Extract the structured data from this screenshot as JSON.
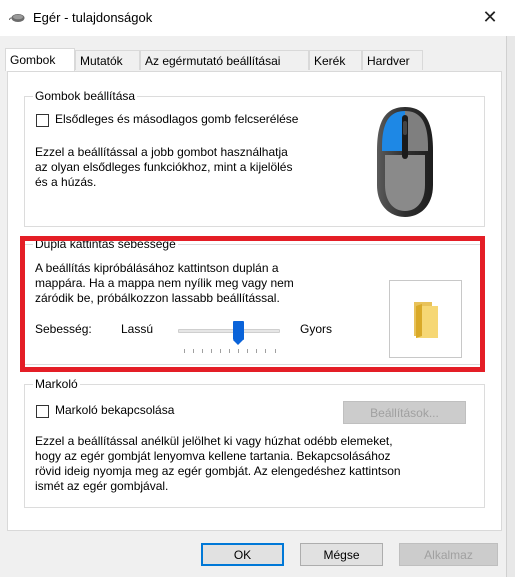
{
  "window": {
    "title": "Egér - tulajdonságok",
    "title_icon": "mouse-icon",
    "close_glyph": "✕"
  },
  "tabs": [
    {
      "label": "Gombok",
      "active": true
    },
    {
      "label": "Mutatók",
      "active": false
    },
    {
      "label": "Az egérmutató beállításai",
      "active": false
    },
    {
      "label": "Kerék",
      "active": false
    },
    {
      "label": "Hardver",
      "active": false
    }
  ],
  "buttons_group": {
    "legend": "Gombok beállítása",
    "swap_checkbox_label": "Elsődleges és másodlagos gomb felcserélése",
    "swap_checked": false,
    "description_lines": [
      "Ezzel a beállítással a jobb gombot használhatja",
      "az olyan elsődleges funkciókhoz, mint a kijelölés",
      "és a húzás."
    ]
  },
  "double_click_group": {
    "legend": "Dupla kattintás sebessége",
    "description_lines": [
      "A beállítás kipróbálásához kattintson duplán a",
      "mappára. Ha a mappa nem nyílik meg vagy nem",
      "záródik be, próbálkozzon lassabb beállítással."
    ],
    "speed_label": "Sebesség:",
    "slow_label": "Lassú",
    "fast_label": "Gyors",
    "slider_value": 0.6,
    "test_folder_icon": "folder-icon"
  },
  "clicklock_group": {
    "legend": "Markoló",
    "checkbox_label": "Markoló bekapcsolása",
    "checked": false,
    "settings_button": "Beállítások...",
    "description_lines": [
      "Ezzel a beállítással anélkül jelölhet ki vagy húzhat odébb elemeket,",
      "hogy az egér gombját lenyomva kellene tartania.  Bekapcsolásához",
      "rövid ideig nyomja meg az egér gombját.  Az elengedéshez kattintson",
      "ismét az egér gombjával."
    ]
  },
  "footer": {
    "ok": "OK",
    "cancel": "Mégse",
    "apply": "Alkalmaz"
  },
  "colors": {
    "highlight_border": "#e41e26",
    "accent": "#0a63d9",
    "mouse_button": "#1e88e5"
  }
}
